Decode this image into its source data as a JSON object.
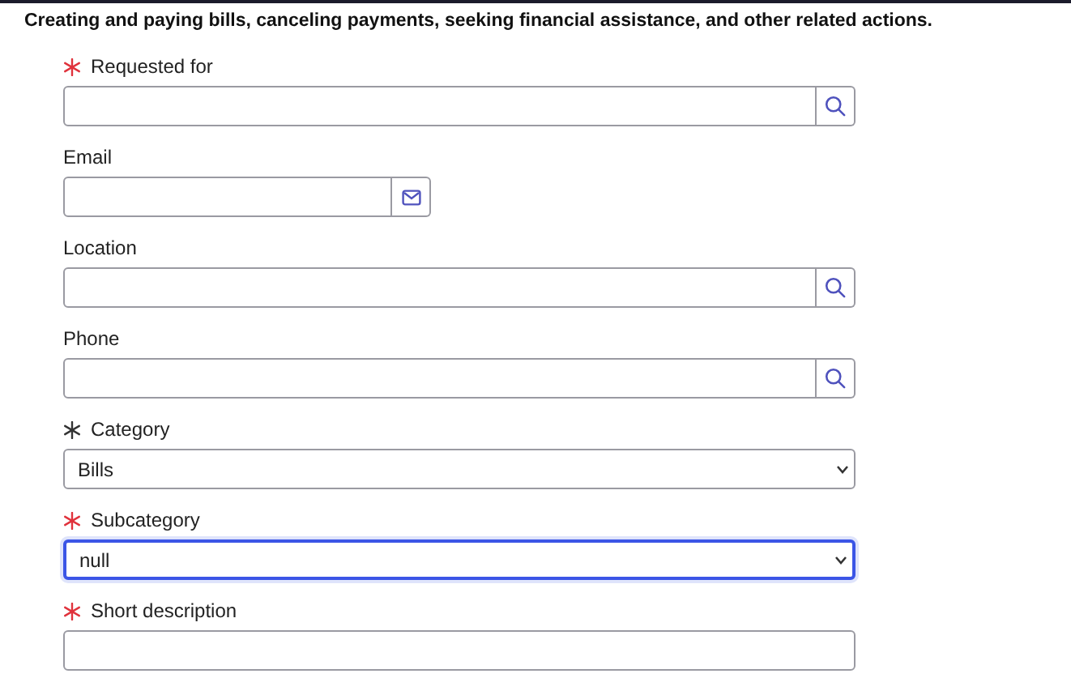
{
  "heading": "Creating and paying bills, canceling payments, seeking financial assistance, and other related actions.",
  "fields": [
    {
      "kind": "lookup",
      "label": "Requested for",
      "required": true,
      "color": "#e0323c",
      "focused": false
    },
    {
      "kind": "email",
      "label": "Email",
      "required": false,
      "focused": false
    },
    {
      "kind": "lookup",
      "label": "Location",
      "required": false,
      "focused": false
    },
    {
      "kind": "lookup",
      "label": "Phone",
      "required": false,
      "focused": false
    },
    {
      "kind": "select",
      "label": "Category",
      "required": true,
      "color": "#333333",
      "focused": false,
      "value": "Bills"
    },
    {
      "kind": "select",
      "label": "Subcategory",
      "required": true,
      "color": "#e0323c",
      "focused": true,
      "value": "null"
    },
    {
      "kind": "text",
      "label": "Short description",
      "required": true,
      "color": "#e0323c",
      "focused": false
    }
  ]
}
